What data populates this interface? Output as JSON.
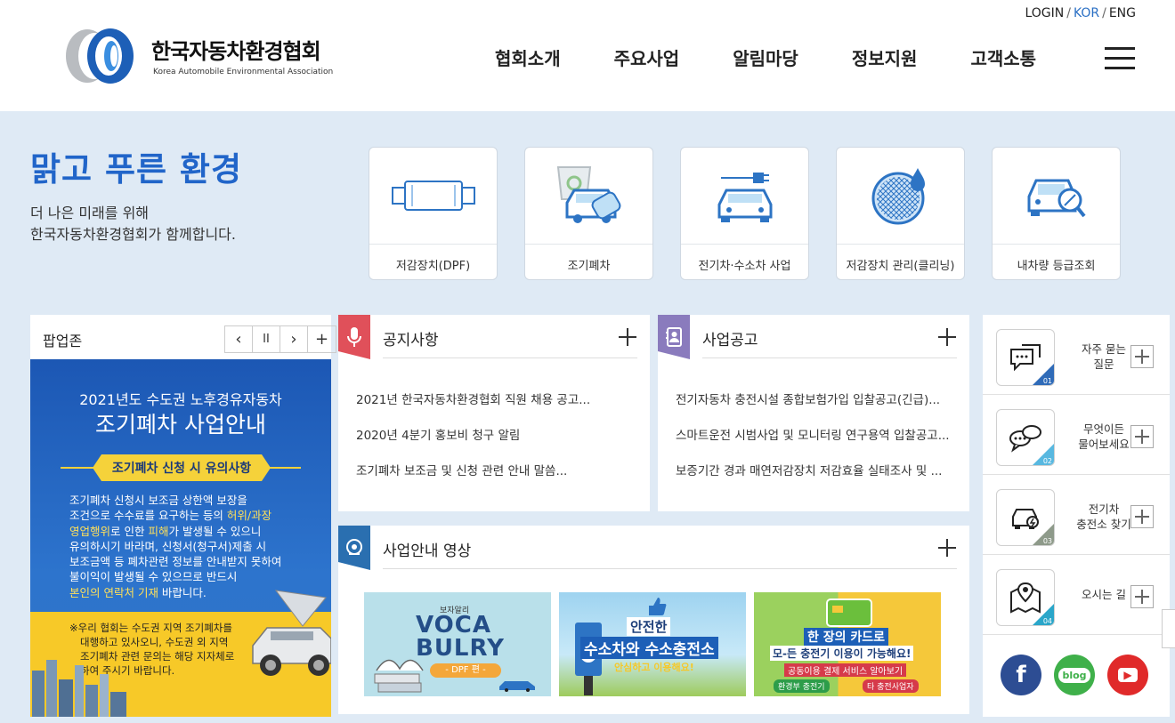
{
  "header": {
    "logo_ko": "한국자동차환경협회",
    "logo_en": "Korea Automobile Environmental Association",
    "util": {
      "login": "LOGIN",
      "kor": "KOR",
      "eng": "ENG",
      "sep": "/"
    },
    "gnb": [
      "협회소개",
      "주요사업",
      "알림마당",
      "정보지원",
      "고객소통"
    ]
  },
  "visual": {
    "slogan": "맑고 푸른 환경",
    "sub1": "더 나은 미래를 위해",
    "sub2": "한국자동차환경협회가 함께합니다."
  },
  "quick_menu": [
    {
      "label": "저감장치(DPF)",
      "icon": "dpf-filter-icon"
    },
    {
      "label": "조기폐차",
      "icon": "scrap-car-icon"
    },
    {
      "label": "전기차·수소차 사업",
      "icon": "electric-car-icon"
    },
    {
      "label": "저감장치 관리(클리닝)",
      "icon": "filter-cleaning-icon"
    },
    {
      "label": "내차량 등급조회",
      "icon": "car-grade-search-icon"
    }
  ],
  "popup": {
    "title": "팝업존",
    "controls": {
      "prev": "‹",
      "pause": "II",
      "next": "›",
      "more": "+"
    },
    "banner": {
      "line1": "2021년도 수도권 노후경유자동차",
      "line2": "조기폐차 사업안내",
      "badge": "조기폐차 신청 시 유의사항",
      "p1": "조기폐차 신청시 보조금 상한액 보장을",
      "p2a": "조건으로 수수료를 요구하는 등의 ",
      "p2b": "허위/과장",
      "p3a": "영업행위",
      "p3b": "로 인한 ",
      "p3c": "피해",
      "p3d": "가 발생될 수 있으니",
      "p4": "유의하시기 바라며, 신청서(청구서)제출 시",
      "p5": "보조금액 등 폐차관련 정보를 안내받지 못하여",
      "p6": "불이익이 발생될 수 있으므로 반드시",
      "p7a": "본인의 연락처 기재",
      "p7b": " 바랍니다.",
      "notice1": "※우리 협회는 수도권 지역 조기폐차를",
      "notice2": "대행하고 있사오니, 수도권 외 지역",
      "notice3": "조기폐차 관련 문의는 해당 지자체로",
      "notice4": "하여 주시기 바랍니다."
    }
  },
  "notice": {
    "title": "공지사항",
    "items": [
      "2021년 한국자동차환경협회 직원 채용 공고...",
      "2020년 4분기 홍보비 청구 알림",
      "조기폐차 보조금 및 신청 관련 안내 말씀..."
    ],
    "color": "#e0505a"
  },
  "business": {
    "title": "사업공고",
    "items": [
      "전기자동차 충전시설 종합보험가입 입찰공고(긴급)...",
      "스마트운전 시범사업 및 모니터링 연구용역 입찰공고...",
      "보증기간 경과 매연저감장치 저감효율 실태조사 및 ..."
    ],
    "color": "#8a7bbd"
  },
  "video": {
    "title": "사업안내 영상",
    "color": "#2a6fb0",
    "thumbs": [
      {
        "t1": "VOCA",
        "t2": "BULRY",
        "tag": "- DPF 편 -",
        "kicker": "보자알리"
      },
      {
        "t1": "안전한",
        "t2": "수소차와 수소충전소",
        "tag": "안심하고 이용해요!"
      },
      {
        "t1": "한 장의 카드로",
        "t2": "모-든 충전기 이용이 가능해요!",
        "tag": "공동이용 결제 서비스 알아보기",
        "b1": "환경부 충전기",
        "b2": "타 충전사업자"
      }
    ]
  },
  "right_quick": [
    {
      "label1": "자주 묻는",
      "label2": "질문",
      "num": "01",
      "color": "#2f6bb8",
      "icon": "faq-chat-icon"
    },
    {
      "label1": "무엇이든",
      "label2": "물어보세요",
      "num": "02",
      "color": "#58b8e0",
      "icon": "ask-chat-icon"
    },
    {
      "label1": "전기차",
      "label2": "충전소 찾기",
      "num": "03",
      "color": "#8e9a8a",
      "icon": "charging-station-icon"
    },
    {
      "label1": "오시는 길",
      "label2": "",
      "num": "04",
      "color": "#2aa6c9",
      "icon": "map-location-icon"
    }
  ],
  "sns": [
    {
      "label": "f",
      "color": "#2d4d93",
      "icon": "facebook-icon"
    },
    {
      "label": "blog",
      "color": "#3fb04a",
      "icon": "blog-icon"
    },
    {
      "label": "▶",
      "color": "#e02a2a",
      "icon": "youtube-icon"
    }
  ]
}
